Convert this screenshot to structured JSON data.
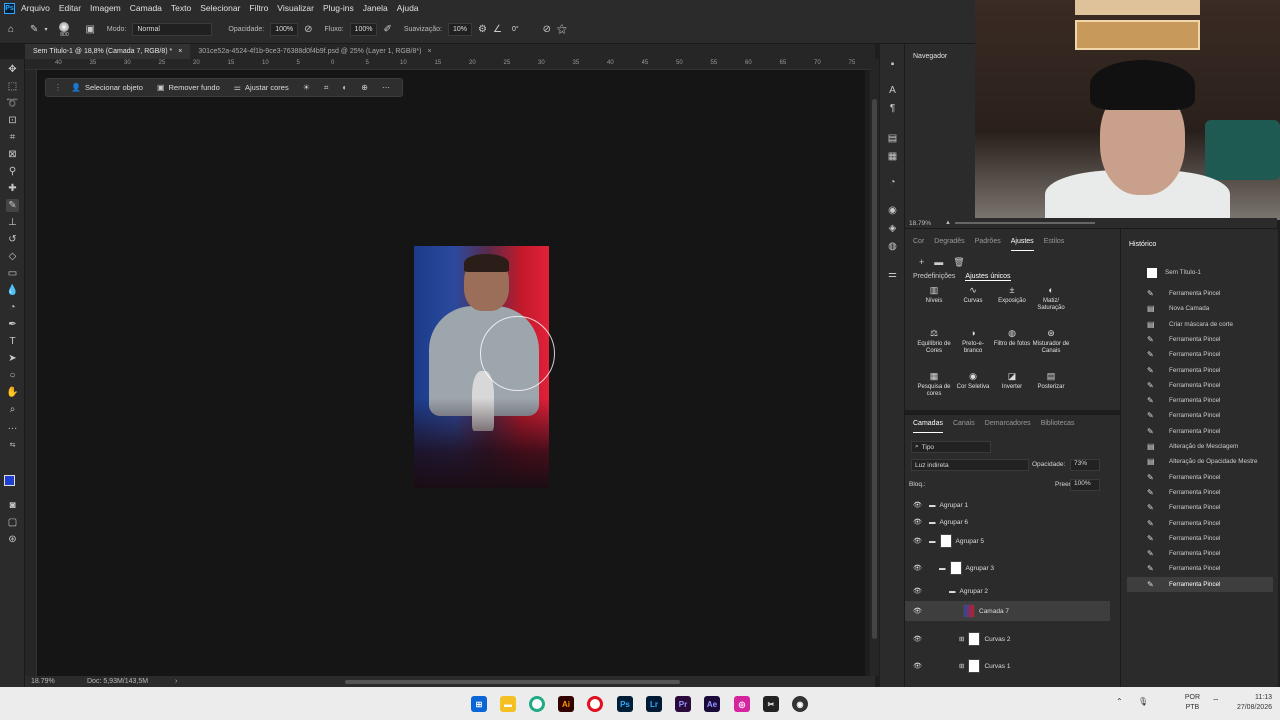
{
  "menubar": {
    "items": [
      "Arquivo",
      "Editar",
      "Imagem",
      "Camada",
      "Texto",
      "Selecionar",
      "Filtro",
      "Visualizar",
      "Plug-ins",
      "Janela",
      "Ajuda"
    ]
  },
  "options": {
    "brush_size": "800",
    "mode_label": "Modo:",
    "mode_value": "Normal",
    "opacity_label": "Opacidade:",
    "opacity_value": "100%",
    "flow_label": "Fluxo:",
    "flow_value": "100%",
    "smooth_label": "Suavização:",
    "smooth_value": "10%",
    "angle_value": "0°"
  },
  "tabs": [
    {
      "label": "Sem Título-1 @ 18,8% (Camada 7, RGB/8) *"
    },
    {
      "label": "301ce52a-4524-4f1b-9ce3-76388d0f4b9f.psd @ 25% (Layer 1, RGB/8*)"
    }
  ],
  "ruler": {
    "ticks": [
      "40",
      "35",
      "30",
      "25",
      "20",
      "15",
      "10",
      "5",
      "0",
      "5",
      "10",
      "15",
      "20",
      "25",
      "30",
      "35",
      "40",
      "45",
      "50",
      "55",
      "60",
      "65",
      "70",
      "75"
    ]
  },
  "context_bar": {
    "select_object": "Selecionar objeto",
    "remove_bg": "Remover fundo",
    "adjust_colors": "Ajustar cores"
  },
  "status": {
    "zoom": "18.79%",
    "doc": "Doc: 5,93M/143,5M"
  },
  "navigator": {
    "title": "Navegador",
    "zoom": "18.79%"
  },
  "adjust_panel": {
    "tabs": [
      "Cor",
      "Degradês",
      "Padrões",
      "Ajustes",
      "Estilos"
    ],
    "active_tab": "Ajustes",
    "subtabs": [
      "Predefinições",
      "Ajustes únicos"
    ],
    "items": [
      {
        "label": "Níveis",
        "icon": "levels-icon"
      },
      {
        "label": "Curvas",
        "icon": "curves-icon"
      },
      {
        "label": "Exposição",
        "icon": "exposure-icon"
      },
      {
        "label": "Matiz/ Saturação",
        "icon": "hue-saturation-icon"
      },
      {
        "label": "Equilíbrio de Cores",
        "icon": "color-balance-icon"
      },
      {
        "label": "Preto-e-branco",
        "icon": "black-white-icon"
      },
      {
        "label": "Filtro de fotos",
        "icon": "photo-filter-icon"
      },
      {
        "label": "Misturador de Canais",
        "icon": "channel-mixer-icon"
      },
      {
        "label": "Pesquisa de cores",
        "icon": "color-lookup-icon"
      },
      {
        "label": "Cor Seletiva",
        "icon": "selective-color-icon"
      },
      {
        "label": "Inverter",
        "icon": "invert-icon"
      },
      {
        "label": "Posterizar",
        "icon": "posterize-icon"
      }
    ]
  },
  "layers_panel": {
    "tabs": [
      "Camadas",
      "Canais",
      "Demarcadores",
      "Bibliotecas"
    ],
    "filter": "Tipo",
    "blend_mode": "Luz indireta",
    "opacity_label": "Opacidade:",
    "opacity_value": "73%",
    "lock_label": "Bloq.:",
    "fill_label": "Preen.:",
    "fill_value": "100%",
    "layers": [
      {
        "name": "Agrupar 1",
        "type": "group"
      },
      {
        "name": "Agrupar 6",
        "type": "group"
      },
      {
        "name": "Agrupar 5",
        "type": "group-mask"
      },
      {
        "name": "Agrupar 3",
        "type": "group-mask"
      },
      {
        "name": "Agrupar 2",
        "type": "group"
      },
      {
        "name": "Camada 7",
        "type": "layer",
        "selected": true
      },
      {
        "name": "Curvas 2",
        "type": "adjustment"
      },
      {
        "name": "Curvas 1",
        "type": "adjustment"
      }
    ]
  },
  "history": {
    "title": "Histórico",
    "snapshot": "Sem Título-1",
    "items": [
      "Ferramenta Pincel",
      "Nova Camada",
      "Criar máscara de corte",
      "Ferramenta Pincel",
      "Ferramenta Pincel",
      "Ferramenta Pincel",
      "Ferramenta Pincel",
      "Ferramenta Pincel",
      "Ferramenta Pincel",
      "Ferramenta Pincel",
      "Alteração de Mesclagem",
      "Alteração de Opacidade Mestre",
      "Ferramenta Pincel",
      "Ferramenta Pincel",
      "Ferramenta Pincel",
      "Ferramenta Pincel",
      "Ferramenta Pincel",
      "Ferramenta Pincel",
      "Ferramenta Pincel",
      "Ferramenta Pincel"
    ]
  },
  "taskbar": {
    "lang1": "POR",
    "lang2": "PTB",
    "time": "11:13",
    "date": "27/08/2026",
    "apps": [
      {
        "label": "Ai",
        "color": "#330000"
      },
      {
        "label": "Ps",
        "color": "#001e36"
      },
      {
        "label": "Lr",
        "color": "#001a33"
      },
      {
        "label": "Pr",
        "color": "#2a0a3a"
      },
      {
        "label": "Ae",
        "color": "#1a0a3a"
      }
    ]
  }
}
